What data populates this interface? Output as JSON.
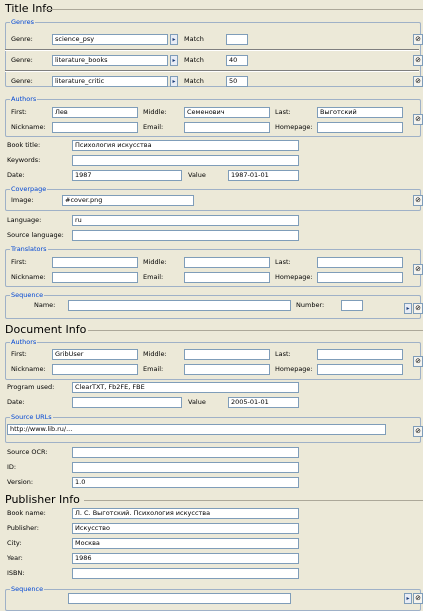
{
  "title_info": {
    "heading": "Title Info",
    "genres_title": "Genres",
    "genre_label": "Genre:",
    "match_label": "Match",
    "genres": [
      {
        "value": "science_psy",
        "match": ""
      },
      {
        "value": "literature_books",
        "match": "40"
      },
      {
        "value": "literature_critic",
        "match": "50"
      }
    ],
    "authors_title": "Authors",
    "first_label": "First:",
    "middle_label": "Middle:",
    "last_label": "Last:",
    "nickname_label": "Nickname:",
    "email_label": "Email:",
    "homepage_label": "Homepage:",
    "author": {
      "first": "Лев",
      "middle": "Семенович",
      "last": "Выготский",
      "nickname": "",
      "email": "",
      "homepage": ""
    },
    "book_title_label": "Book title:",
    "book_title": "Психология искусства",
    "keywords_label": "Keywords:",
    "keywords": "",
    "date_label": "Date:",
    "date": "1987",
    "value_label": "Value",
    "date_value": "1987-01-01",
    "coverpage_title": "Coverpage",
    "image_label": "Image:",
    "image_value": "#cover.png",
    "language_label": "Language:",
    "language": "ru",
    "source_language_label": "Source language:",
    "source_language": "",
    "translators_title": "Translators",
    "translator": {
      "first": "",
      "middle": "",
      "last": "",
      "nickname": "",
      "email": "",
      "homepage": ""
    },
    "sequence_title": "Sequence",
    "name_label": "Name:",
    "number_label": "Number:",
    "sequence_name": "",
    "sequence_number": ""
  },
  "document_info": {
    "heading": "Document Info",
    "authors_title": "Authors",
    "author": {
      "first": "GribUser",
      "middle": "",
      "last": "",
      "nickname": "",
      "email": "",
      "homepage": ""
    },
    "program_used_label": "Program used:",
    "program_used": "ClearTXT, Fb2FE, FBE",
    "date_label": "Date:",
    "date": "",
    "value_label": "Value",
    "date_value": "2005-01-01",
    "source_urls_title": "Source URLs",
    "source_url": "http://www.lib.ru/...",
    "source_ocr_label": "Source OCR:",
    "source_ocr": "",
    "id_label": "ID:",
    "id": "",
    "version_label": "Version:",
    "version": "1.0"
  },
  "publisher_info": {
    "heading": "Publisher Info",
    "book_name_label": "Book name:",
    "book_name": "Л. С. Выготский. Психология искусства",
    "publisher_label": "Publisher:",
    "publisher": "Искусство",
    "city_label": "City:",
    "city": "Москва",
    "year_label": "Year:",
    "year": "1986",
    "isbn_label": "ISBN:",
    "isbn": "",
    "sequence_title": "Sequence"
  },
  "icons": {
    "dropdown": "chevron-right-icon",
    "remove": "remove-icon"
  }
}
